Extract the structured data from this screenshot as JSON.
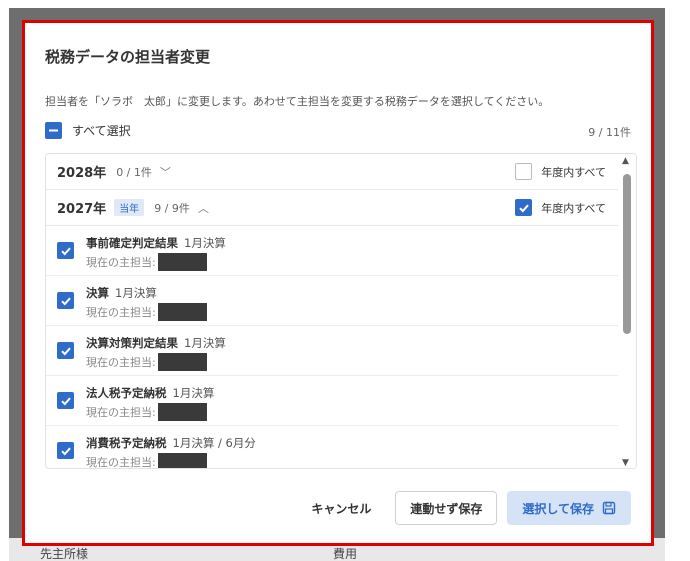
{
  "background": {
    "left_text": "先主所様",
    "right_text": "費用"
  },
  "modal": {
    "title": "税務データの担当者変更",
    "description": "担当者を「ソラボ　太郎」に変更します。あわせて主担当を変更する税務データを選択してください。",
    "select_all_label": "すべて選択",
    "selected_count": "9 / 11件"
  },
  "years": [
    {
      "label": "2028年",
      "count": "0 / 1件",
      "chevron": "﹀",
      "badge": "",
      "all_label": "年度内すべて",
      "checked": false
    },
    {
      "label": "2027年",
      "count": "9 / 9件",
      "chevron": "︿",
      "badge": "当年",
      "all_label": "年度内すべて",
      "checked": true
    }
  ],
  "items": [
    {
      "name": "事前確定判定結果",
      "period": "1月決算",
      "owner_label": "現在の主担当:"
    },
    {
      "name": "決算",
      "period": "1月決算",
      "owner_label": "現在の主担当:"
    },
    {
      "name": "決算対策判定結果",
      "period": "1月決算",
      "owner_label": "現在の主担当:"
    },
    {
      "name": "法人税予定納税",
      "period": "1月決算",
      "owner_label": "現在の主担当:"
    },
    {
      "name": "消費税予定納税",
      "period": "1月決算 / 6月分",
      "owner_label": "現在の主担当:"
    }
  ],
  "footer": {
    "cancel_label": "キャンセル",
    "save_no_link_label": "連動せず保存",
    "save_selected_label": "選択して保存"
  },
  "colors": {
    "accent": "#2f6cc9",
    "highlight_border": "#e00000"
  }
}
